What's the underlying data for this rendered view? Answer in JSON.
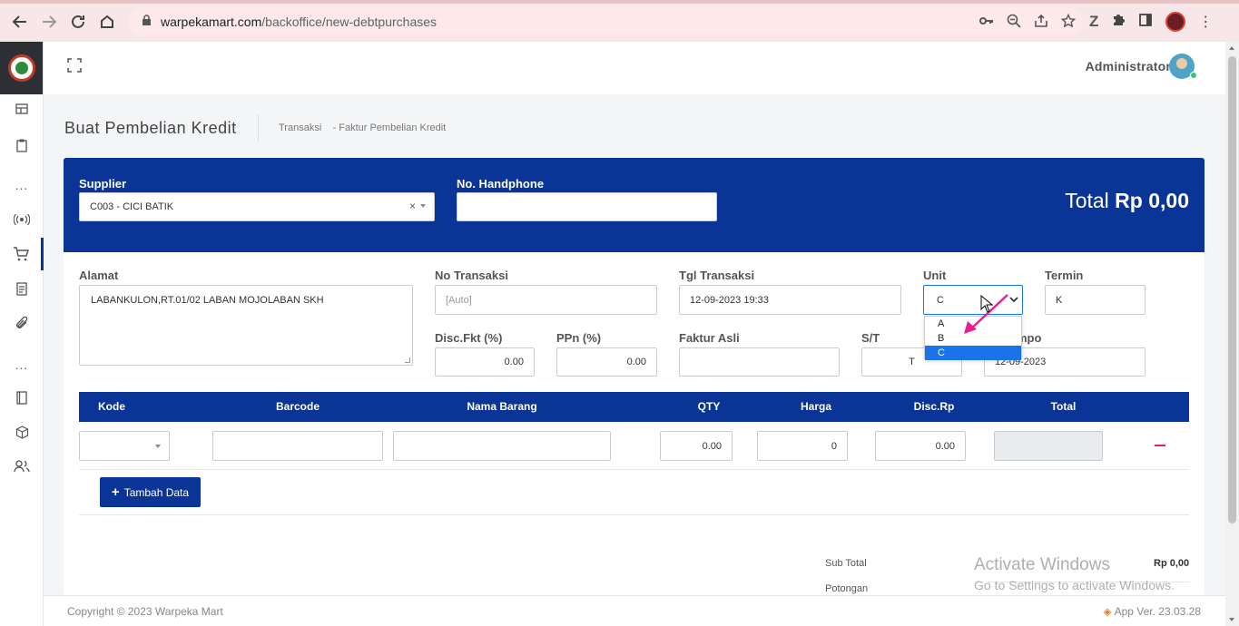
{
  "browser": {
    "url_host": "warpekamart.com",
    "url_path": "/backoffice/new-debtpurchases"
  },
  "topbar": {
    "admin_name": "Administrator"
  },
  "page": {
    "title": "Buat Pembelian Kredit",
    "breadcrumb_root": "Transaksi",
    "breadcrumb_current": "- Faktur Pembelian Kredit"
  },
  "header_form": {
    "supplier_label": "Supplier",
    "supplier_value": "C003 - CICI BATIK",
    "phone_label": "No. Handphone",
    "phone_value": "",
    "total_label": "Total",
    "total_value": "Rp 0,00"
  },
  "form": {
    "alamat_label": "Alamat",
    "alamat_value": "LABANKULON,RT.01/02 LABAN MOJOLABAN SKH",
    "no_transaksi_label": "No Transaksi",
    "no_transaksi_placeholder": "[Auto]",
    "tgl_transaksi_label": "Tgl Transaksi",
    "tgl_transaksi_value": "12-09-2023 19:33",
    "unit_label": "Unit",
    "unit_value": "C",
    "unit_options": [
      "A",
      "B",
      "C"
    ],
    "termin_label": "Termin",
    "termin_value": "K",
    "disc_fkt_label": "Disc.Fkt (%)",
    "disc_fkt_value": "0.00",
    "ppn_label": "PPn (%)",
    "ppn_value": "0.00",
    "faktur_asli_label": "Faktur Asli",
    "faktur_asli_value": "",
    "st_label": "S/T",
    "st_value": "T",
    "jatuh_tempo_label_visible": "mpo",
    "jatuh_tempo_value": "12-09-2023"
  },
  "table": {
    "columns": [
      "Kode",
      "Barcode",
      "Nama Barang",
      "QTY",
      "Harga",
      "Disc.Rp",
      "Total"
    ],
    "row": {
      "qty": "0.00",
      "harga": "0",
      "disc_rp": "0.00"
    },
    "add_button_label": "Tambah Data"
  },
  "summary": {
    "sub_total_label": "Sub Total",
    "sub_total_value": "Rp 0,00",
    "potongan_label": "Potongan"
  },
  "footer": {
    "copyright": "Copyright © 2023 Warpeka Mart",
    "version": "App Ver. 23.03.28"
  },
  "watermark": {
    "line1": "Activate Windows",
    "line2": "Go to Settings to activate Windows."
  },
  "colors": {
    "primary": "#0a3597",
    "select_highlight": "#1a73e8",
    "remove": "#e0245e",
    "annotation_arrow": "#e91e8c"
  }
}
